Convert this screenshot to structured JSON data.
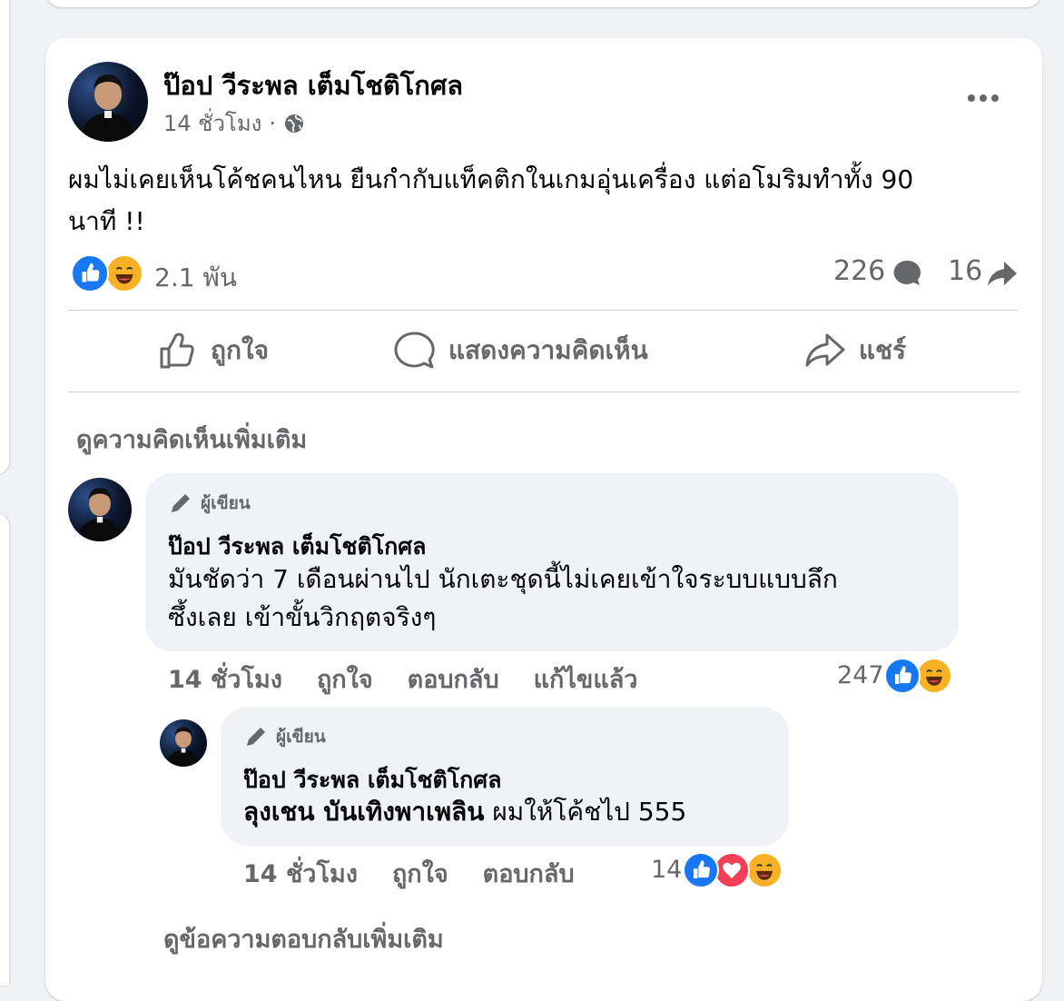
{
  "post": {
    "author": "ป๊อป วีระพล เต็มโชติโกศล",
    "time": "14 ชั่วโมง",
    "separator": "·",
    "text_line1": "ผมไม่เคยเห็นโค้ชคนไหน ยืนกำกับแท็คติกในเกมอุ่นเครื่อง แต่อโมริมทำทั้ง 90",
    "text_line2": "นาที !!",
    "reactions_count": "2.1 พัน",
    "comments_count": "226",
    "shares_count": "16",
    "actions": {
      "like": "ถูกใจ",
      "comment": "แสดงความคิดเห็น",
      "share": "แชร์"
    },
    "more_comments": "ดูความคิดเห็นเพิ่มเติม"
  },
  "comment1": {
    "badge": "ผู้เขียน",
    "author": "ป๊อป วีระพล เต็มโชติโกศล",
    "text_line1": "มันชัดว่า 7 เดือนผ่านไป นักเตะชุดนี้ไม่เคยเข้าใจระบบแบบลึก",
    "text_line2": "ซึ้งเลย เข้าขั้นวิกฤตจริงๆ",
    "time": "14 ชั่วโมง",
    "like": "ถูกใจ",
    "reply": "ตอบกลับ",
    "edited": "แก้ไขแล้ว",
    "reactions_count": "247"
  },
  "reply1": {
    "badge": "ผู้เขียน",
    "author": "ป๊อป วีระพล เต็มโชติโกศล",
    "mention": "ลุงเชน บันเทิงพาเพลิน",
    "text": "ผมให้โค้ชไป 555",
    "time": "14 ชั่วโมง",
    "like": "ถูกใจ",
    "reply": "ตอบกลับ",
    "reactions_count": "14"
  },
  "more_replies": "ดูข้อความตอบกลับเพิ่มเติม",
  "colors": {
    "background": "#f0f2f5",
    "secondary_text": "#65676b",
    "like_blue": "#1877f2",
    "haha_yellow": "#f7b125",
    "love_red": "#f33e58"
  }
}
